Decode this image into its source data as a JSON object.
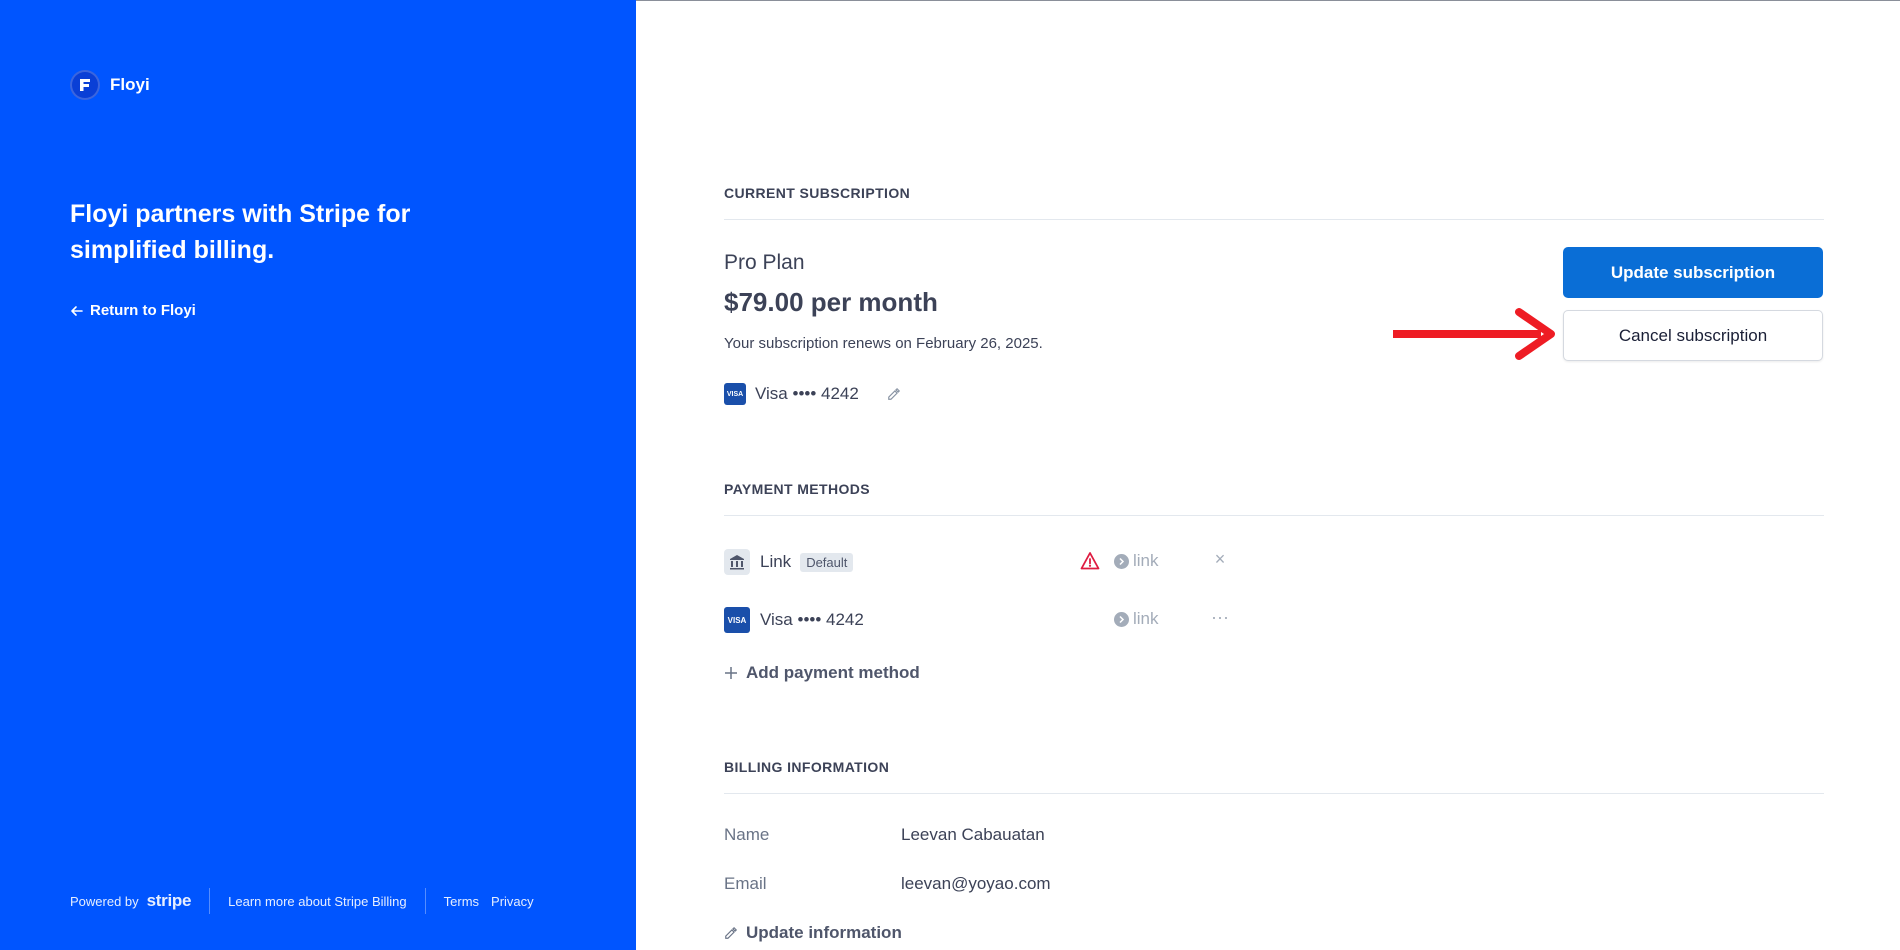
{
  "brand": {
    "name": "Floyi",
    "logo_letter": "F"
  },
  "left_panel": {
    "headline": "Floyi partners with Stripe for simplified billing.",
    "return_link": "Return to Floyi",
    "footer": {
      "powered_by": "Powered by",
      "stripe": "stripe",
      "learn_more": "Learn more about Stripe Billing",
      "terms": "Terms",
      "privacy": "Privacy"
    },
    "background_color": "#0055ff"
  },
  "subscription": {
    "section_title": "CURRENT SUBSCRIPTION",
    "plan_name": "Pro Plan",
    "price": "$79.00 per month",
    "renewal": "Your subscription renews on February 26, 2025.",
    "card": {
      "badge": "VISA",
      "label": "Visa •••• 4242"
    },
    "update_button": "Update subscription",
    "cancel_button": "Cancel subscription"
  },
  "payment_methods": {
    "section_title": "PAYMENT METHODS",
    "items": [
      {
        "icon": "bank-icon",
        "label": "Link",
        "badge": "Default",
        "status_icon": "warning-icon",
        "link_label": "link",
        "action": "×"
      },
      {
        "icon": "visa-icon",
        "badge_text": "VISA",
        "label": "Visa •••• 4242",
        "link_label": "link",
        "action": "···"
      }
    ],
    "add_label": "Add payment method"
  },
  "billing": {
    "section_title": "BILLING INFORMATION",
    "rows": [
      {
        "label": "Name",
        "value": "Leevan Cabauatan"
      },
      {
        "label": "Email",
        "value": "leevan@yoyao.com"
      }
    ],
    "update_label": "Update information"
  },
  "colors": {
    "primary_button": "#0a6ed6",
    "annotation_arrow": "#ee1c24",
    "warning": "#df1b41"
  }
}
